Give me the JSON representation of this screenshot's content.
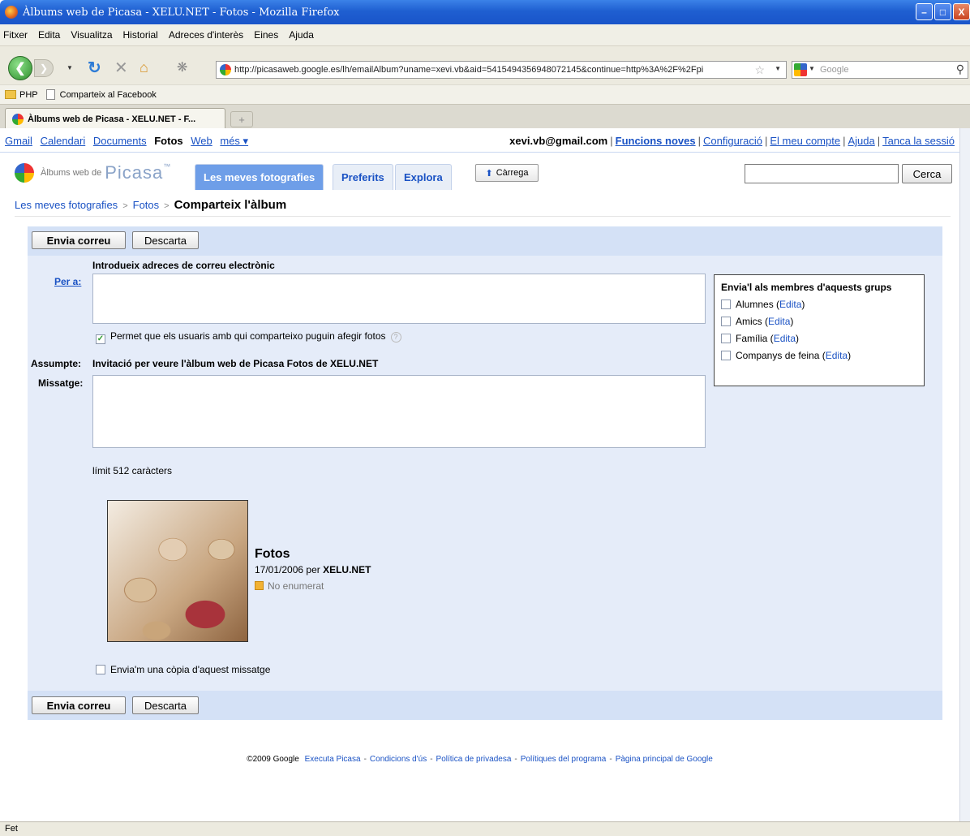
{
  "window": {
    "title": "Àlbums web de Picasa - XELU.NET - Fotos - Mozilla Firefox",
    "min": "–",
    "max": "□",
    "close": "X"
  },
  "menu": [
    "Fitxer",
    "Edita",
    "Visualitza",
    "Historial",
    "Adreces d'interès",
    "Eines",
    "Ajuda"
  ],
  "nav": {
    "url": "http://picasaweb.google.es/lh/emailAlbum?uname=xevi.vb&aid=5415494356948072145&continue=http%3A%2F%2Fpi",
    "search_placeholder": "Google"
  },
  "bookmarks": [
    "PHP",
    "Comparteix al Facebook"
  ],
  "tab": {
    "label": "Àlbums web de Picasa - XELU.NET - F..."
  },
  "gbar": {
    "links": [
      "Gmail",
      "Calendari",
      "Documents",
      "Fotos",
      "Web",
      "més ▾"
    ],
    "account": "xevi.vb@gmail.com",
    "right_links": [
      "Funcions noves",
      "Configuració",
      "El meu compte",
      "Ajuda",
      "Tanca la sessió"
    ]
  },
  "picasa": {
    "logo_small": "Àlbums web de",
    "logo_big": "Picasa",
    "logo_tm": "™",
    "tabs": [
      "Les meves fotografies",
      "Preferits",
      "Explora"
    ],
    "upload": "Càrrega",
    "search_button": "Cerca"
  },
  "breadcrumb": [
    "Les meves fotografies",
    "Fotos",
    "Comparteix l'àlbum"
  ],
  "form": {
    "send_button": "Envia correu",
    "discard_button": "Descarta",
    "emails_heading": "Introdueix adreces de correu electrònic",
    "to_label": "Per a:",
    "allow_add_label": "Permet que els usuaris amb qui comparteixo puguin afegir fotos",
    "allow_add_checked": true,
    "subject_label": "Assumpte:",
    "subject_value": "Invitació per veure l'àlbum web de Picasa Fotos de XELU.NET",
    "message_label": "Missatge:",
    "limit_text": "límit 512 caràcters",
    "copy_label": "Envia'm una còpia d'aquest missatge",
    "copy_checked": false
  },
  "groups": {
    "title": "Envia'l als membres d'aquests grups",
    "edit_label": "Edita",
    "items": [
      "Alumnes",
      "Amics",
      "Família",
      "Companys de feina"
    ]
  },
  "album": {
    "title": "Fotos",
    "date": "17/01/2006 per",
    "owner": "XELU.NET",
    "visibility": "No enumerat"
  },
  "footer": {
    "copyright": "©2009 Google",
    "links": [
      "Executa Picasa",
      "Condicions d'ús",
      "Política de privadesa",
      "Polítiques del programa",
      "Pàgina principal de Google"
    ]
  },
  "status": "Fet",
  "colors": {
    "panel": "#e5ecf9",
    "actionbar": "#d4e1f6",
    "link": "#1a52c4",
    "titlebar": "#1f5fd1"
  }
}
